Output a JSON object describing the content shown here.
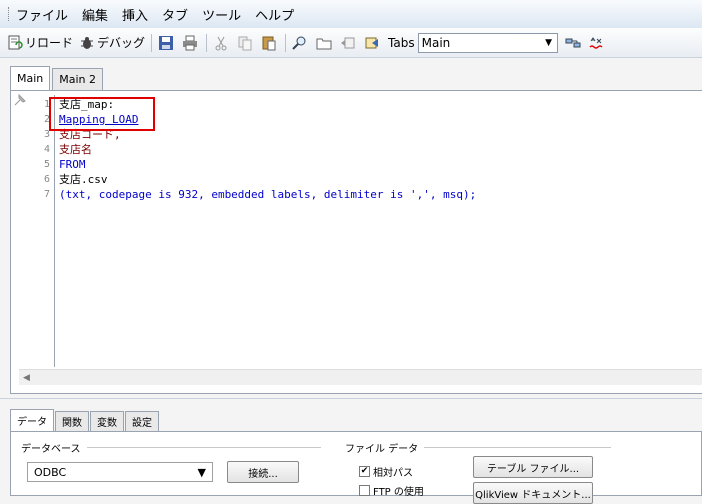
{
  "menu": {
    "items": [
      "ファイル",
      "編集",
      "挿入",
      "タブ",
      "ツール",
      "ヘルプ"
    ]
  },
  "toolbar": {
    "reload_label": "リロード",
    "debug_label": "デバッグ",
    "tabs_label": "Tabs",
    "tabs_selected": "Main",
    "icons": [
      "reload-icon",
      "debug-icon",
      "save-icon",
      "print-icon",
      "cut-icon",
      "copy-icon",
      "paste-icon",
      "find-icon",
      "open-folder-icon",
      "back-icon",
      "table-files-icon",
      "add-tab-icon",
      "syntax-check-icon"
    ]
  },
  "editor": {
    "tabs": [
      "Main",
      "Main 2"
    ],
    "active_tab": "Main",
    "line_numbers": [
      "1",
      "2",
      "3",
      "4",
      "5",
      "6",
      "7"
    ],
    "lines": [
      "支店_map:",
      "Mapping LOAD",
      "支店コード,",
      "支店名",
      "FROM",
      "支店.csv",
      "(txt, codepage is 932, embedded labels, delimiter is ',', msq);"
    ],
    "colors": {
      "keyword": "#0000cc",
      "field": "#7a0000",
      "highlight_box": "#e00000"
    }
  },
  "bottom": {
    "tabs": [
      "データ",
      "関数",
      "変数",
      "設定"
    ],
    "active_tab": "データ",
    "database_group": "データベース",
    "database_value": "ODBC",
    "connect_button": "接続...",
    "file_data_group": "ファイル データ",
    "relative_path_label": "相対パス",
    "relative_path_checked": true,
    "use_ftp_label": "FTP の使用",
    "use_ftp_checked": false,
    "table_files_button": "テーブル ファイル...",
    "qlikview_doc_button": "QlikView ドキュメント..."
  }
}
